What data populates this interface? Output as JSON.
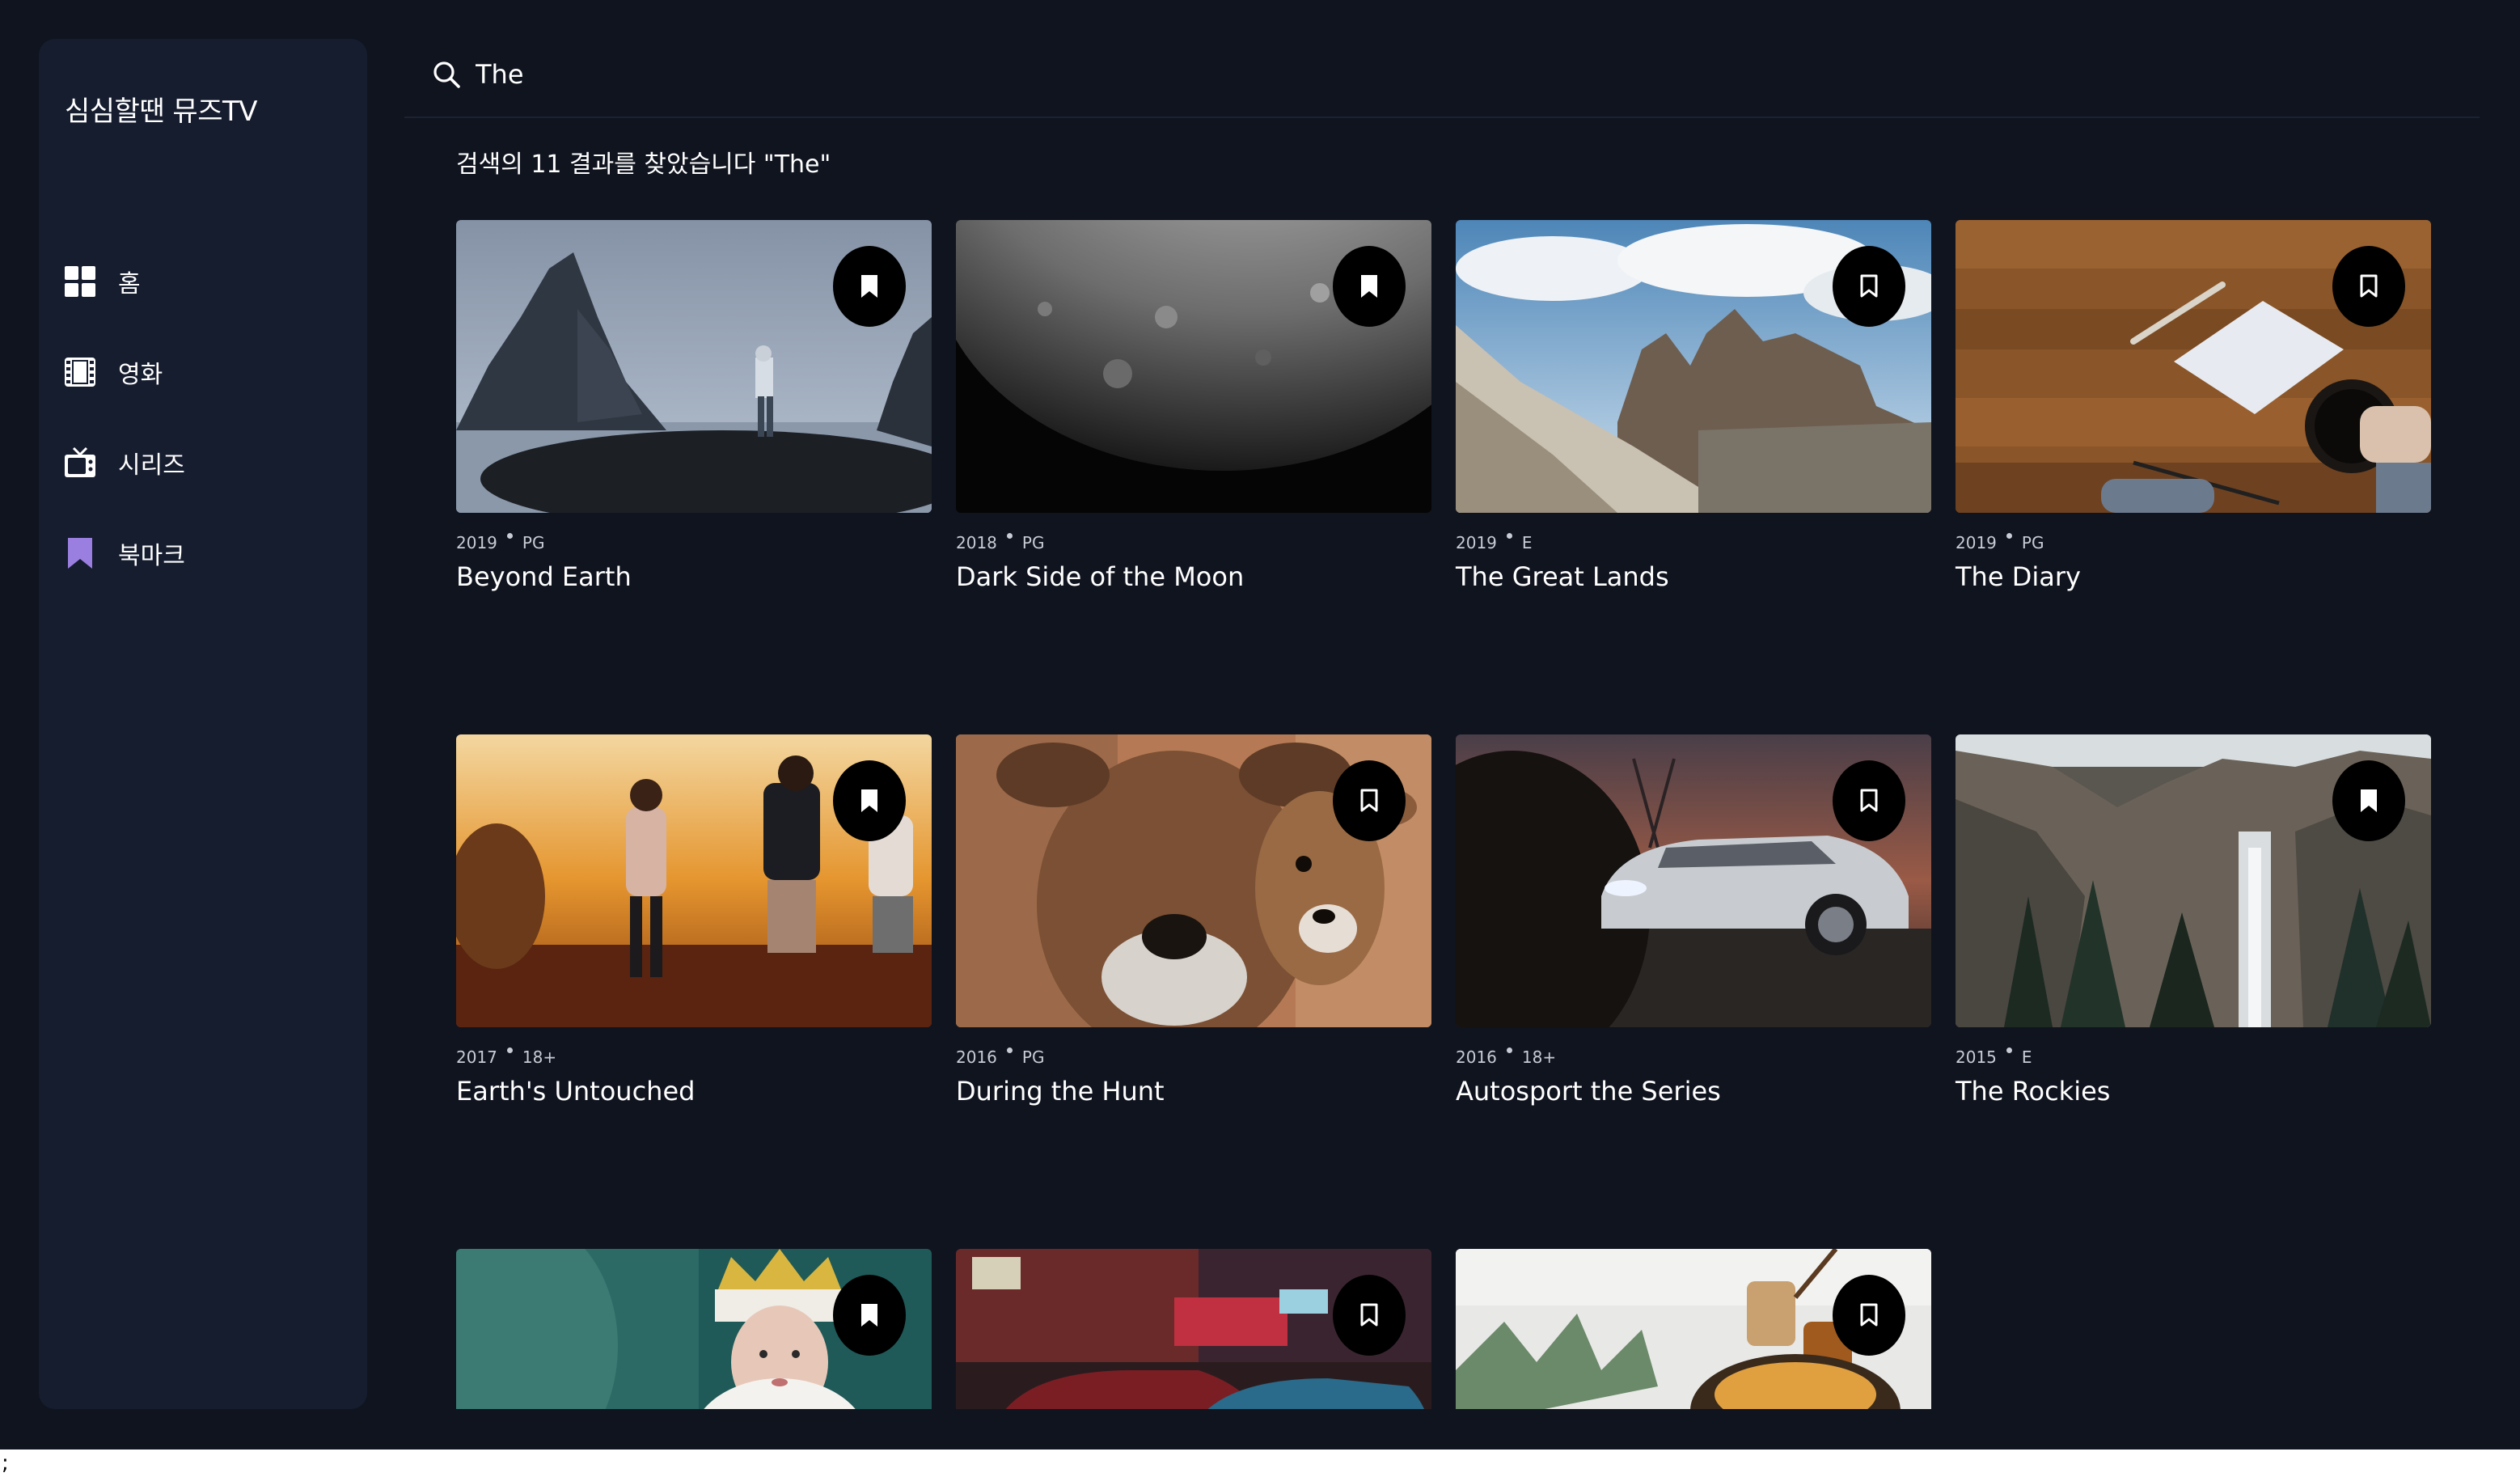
{
  "app": {
    "name": "심심할땐 뮤즈TV"
  },
  "sidebar": {
    "items": [
      {
        "label": "홈",
        "icon": "grid-icon",
        "active": false
      },
      {
        "label": "영화",
        "icon": "film-icon",
        "active": false
      },
      {
        "label": "시리즈",
        "icon": "tv-icon",
        "active": false
      },
      {
        "label": "북마크",
        "icon": "bookmark-icon",
        "active": true
      }
    ]
  },
  "search": {
    "value": "The",
    "placeholder": ""
  },
  "results": {
    "summary": "검색의 11 결과를 찾았습니다 \"The\""
  },
  "movies": [
    {
      "year": "2019",
      "rating": "PG",
      "title": "Beyond Earth",
      "bookmarked": true
    },
    {
      "year": "2018",
      "rating": "PG",
      "title": "Dark Side of the Moon",
      "bookmarked": true
    },
    {
      "year": "2019",
      "rating": "E",
      "title": "The Great Lands",
      "bookmarked": false
    },
    {
      "year": "2019",
      "rating": "PG",
      "title": "The Diary",
      "bookmarked": false
    },
    {
      "year": "2017",
      "rating": "18+",
      "title": "Earth's Untouched",
      "bookmarked": true
    },
    {
      "year": "2016",
      "rating": "PG",
      "title": "During the Hunt",
      "bookmarked": false
    },
    {
      "year": "2016",
      "rating": "18+",
      "title": "Autosport the Series",
      "bookmarked": false
    },
    {
      "year": "2015",
      "rating": "E",
      "title": "The Rockies",
      "bookmarked": true
    },
    {
      "year": "",
      "rating": "",
      "title": "",
      "bookmarked": true
    },
    {
      "year": "",
      "rating": "",
      "title": "",
      "bookmarked": false
    },
    {
      "year": "",
      "rating": "",
      "title": "",
      "bookmarked": false
    }
  ],
  "colors": {
    "background": "#10141f",
    "sidebar": "#161d2f",
    "accent": "#9b7fe0",
    "text": "#ffffff"
  }
}
